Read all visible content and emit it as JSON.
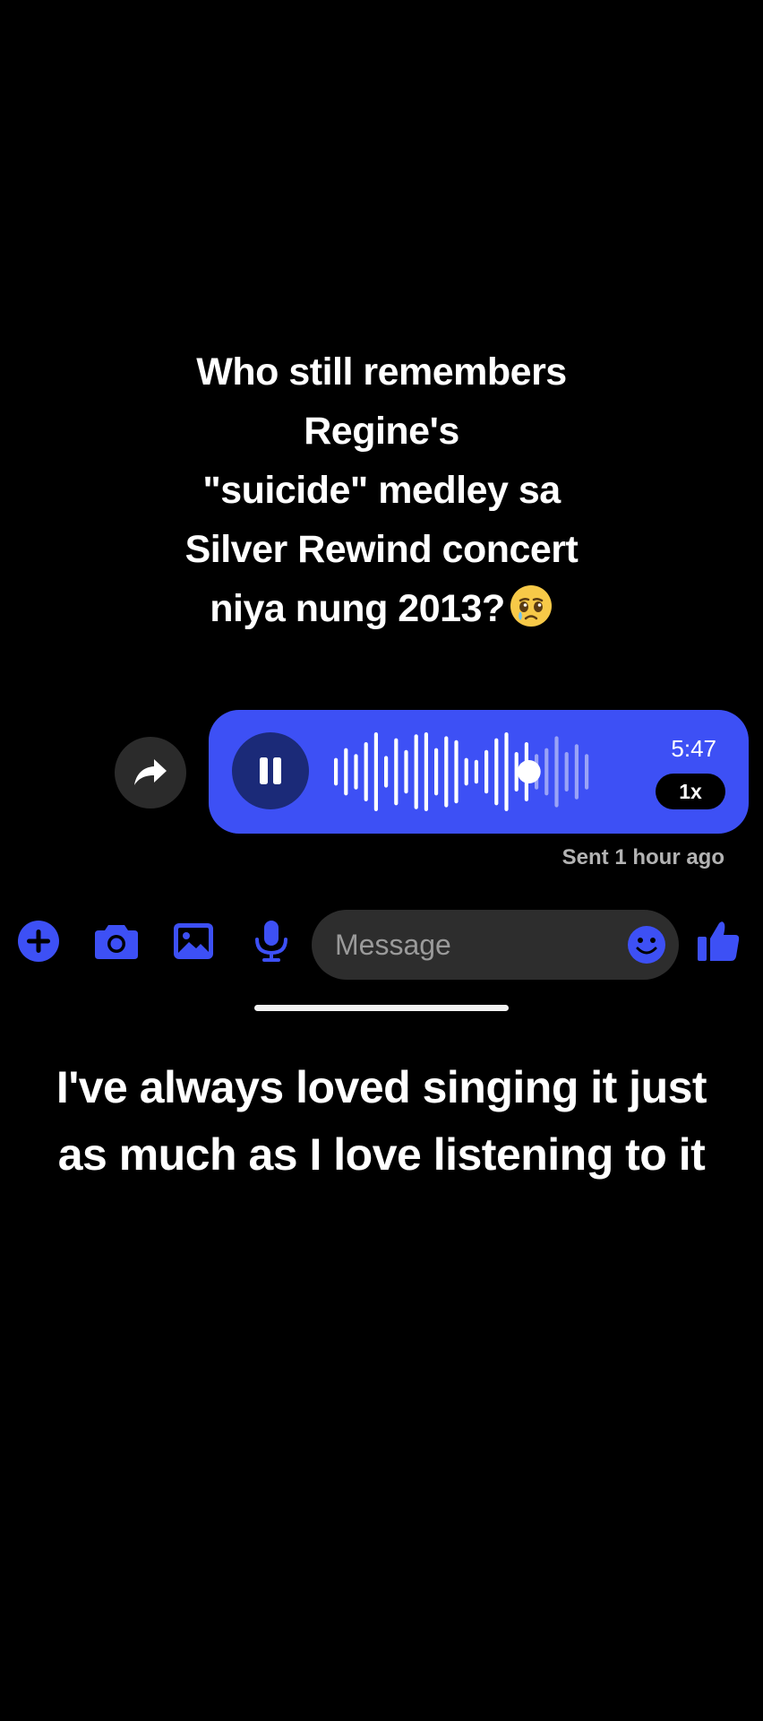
{
  "caption_top": {
    "lines": [
      "Who still remembers",
      "Regine's",
      "\"suicide\" medley sa",
      "Silver Rewind concert",
      "niya nung 2013?"
    ],
    "emoji": "crying-face-emoji"
  },
  "voice_message": {
    "duration": "5:47",
    "speed": "1x",
    "playback_state": "playing",
    "progress": 0.77,
    "waveform_levels": [
      0.35,
      0.6,
      0.45,
      0.75,
      1.0,
      0.4,
      0.85,
      0.55,
      0.95,
      1.0,
      0.6,
      0.9,
      0.8,
      0.35,
      0.3,
      0.55,
      0.85,
      1.0,
      0.5,
      0.75,
      0.45,
      0.6,
      0.9,
      0.5,
      0.7,
      0.45
    ],
    "bubble_color": "#3d50f5",
    "pause_button_color": "#1b2a78"
  },
  "sent_status": "Sent 1 hour ago",
  "composer": {
    "placeholder": "Message",
    "icons": [
      "plus-icon",
      "camera-icon",
      "image-icon",
      "microphone-icon",
      "emoji-icon",
      "thumbs-up-icon"
    ],
    "accent_color": "#3d50f5"
  },
  "caption_bottom": {
    "lines": [
      "I've always loved singing it just",
      "as much as I love listening to it"
    ]
  }
}
